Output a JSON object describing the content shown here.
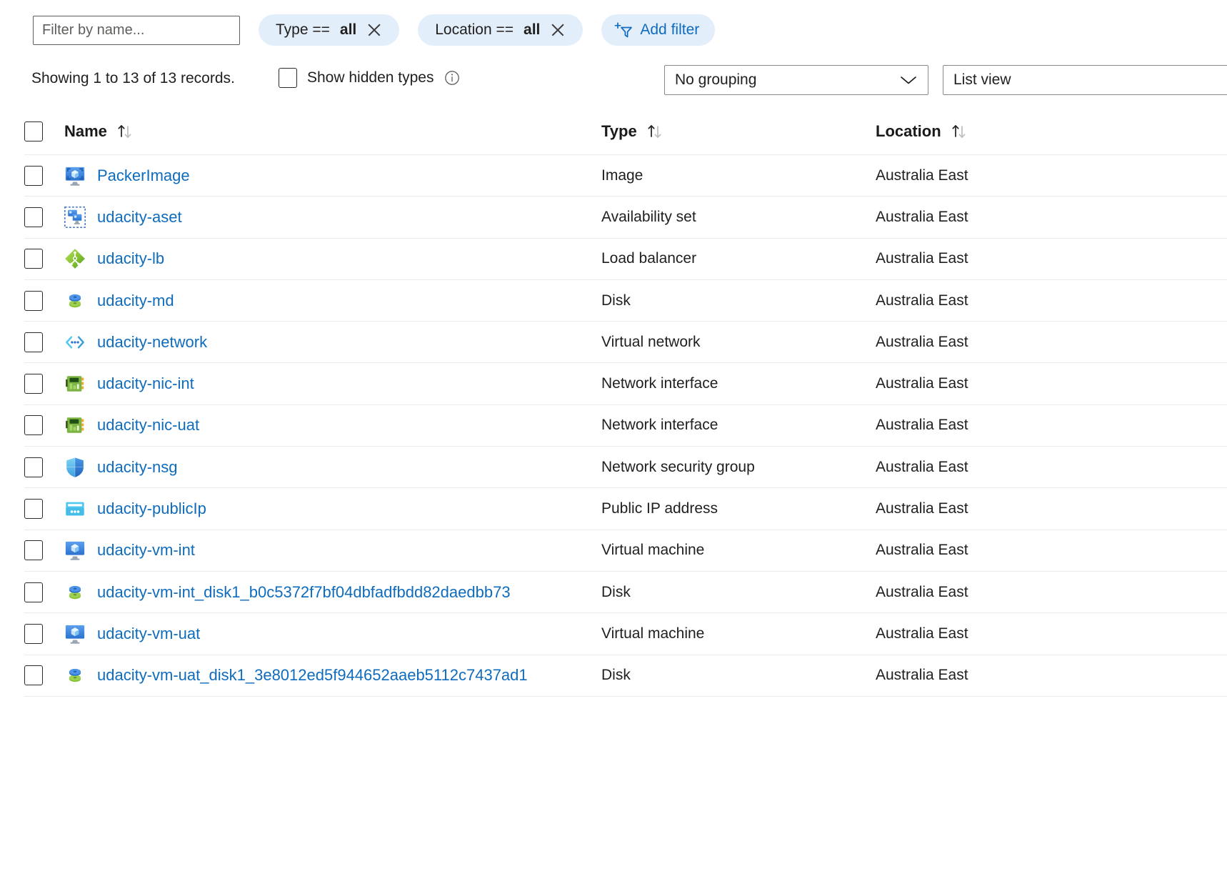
{
  "filter_bar": {
    "name_filter_placeholder": "Filter by name...",
    "name_filter_value": "",
    "pills": [
      {
        "label": "Type ==",
        "value": "all",
        "close_icon": "close-icon"
      },
      {
        "label": "Location ==",
        "value": "all",
        "close_icon": "close-icon"
      }
    ],
    "add_filter_label": "Add filter",
    "add_filter_icon": "add-filter-funnel-icon"
  },
  "sub_bar": {
    "records_text": "Showing 1 to 13 of 13 records.",
    "show_hidden_types_label": "Show hidden types",
    "show_hidden_types_checked": false,
    "info_icon": "info-icon",
    "grouping_value": "No grouping",
    "grouping_chevron_icon": "chevron-down-icon",
    "view_value": "List view"
  },
  "table": {
    "columns": {
      "name": "Name",
      "type": "Type",
      "location": "Location"
    },
    "sort_icon": "sort-arrows-icon",
    "select_all_checked": false,
    "rows": [
      {
        "name": "PackerImage",
        "type": "Image",
        "location": "Australia East",
        "icon": "image-icon"
      },
      {
        "name": "udacity-aset",
        "type": "Availability set",
        "location": "Australia East",
        "icon": "availability-set-icon"
      },
      {
        "name": "udacity-lb",
        "type": "Load balancer",
        "location": "Australia East",
        "icon": "load-balancer-icon"
      },
      {
        "name": "udacity-md",
        "type": "Disk",
        "location": "Australia East",
        "icon": "disk-icon"
      },
      {
        "name": "udacity-network",
        "type": "Virtual network",
        "location": "Australia East",
        "icon": "virtual-network-icon"
      },
      {
        "name": "udacity-nic-int",
        "type": "Network interface",
        "location": "Australia East",
        "icon": "network-interface-icon"
      },
      {
        "name": "udacity-nic-uat",
        "type": "Network interface",
        "location": "Australia East",
        "icon": "network-interface-icon"
      },
      {
        "name": "udacity-nsg",
        "type": "Network security group",
        "location": "Australia East",
        "icon": "network-security-group-icon"
      },
      {
        "name": "udacity-publicIp",
        "type": "Public IP address",
        "location": "Australia East",
        "icon": "public-ip-icon"
      },
      {
        "name": "udacity-vm-int",
        "type": "Virtual machine",
        "location": "Australia East",
        "icon": "virtual-machine-icon"
      },
      {
        "name": "udacity-vm-int_disk1_b0c5372f7bf04dbfadfbdd82daedbb73",
        "type": "Disk",
        "location": "Australia East",
        "icon": "disk-icon"
      },
      {
        "name": "udacity-vm-uat",
        "type": "Virtual machine",
        "location": "Australia East",
        "icon": "virtual-machine-icon"
      },
      {
        "name": "udacity-vm-uat_disk1_3e8012ed5f944652aaeb5112c7437ad1",
        "type": "Disk",
        "location": "Australia East",
        "icon": "disk-icon"
      }
    ]
  },
  "colors": {
    "link": "#0f6cbd",
    "pill_bg": "#e3eefb",
    "row_divider": "#edebe9",
    "text": "#201f1e"
  }
}
